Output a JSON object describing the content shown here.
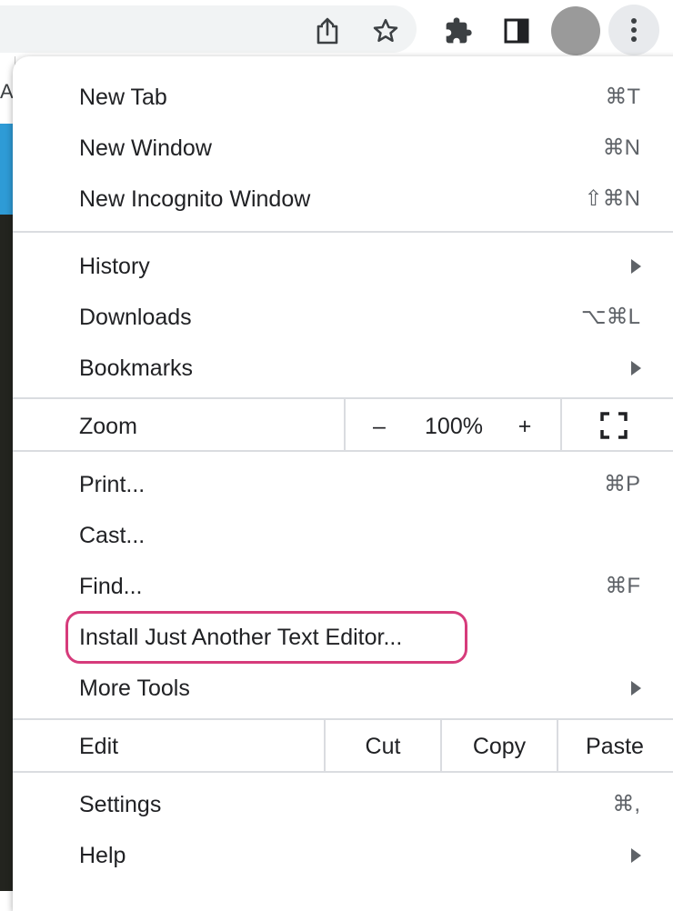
{
  "toolbar": {
    "icons": [
      "share-icon",
      "star-icon",
      "extensions-icon",
      "side-panel-icon",
      "profile-avatar",
      "more-menu-icon"
    ]
  },
  "page_behind": {
    "fragment": "AF"
  },
  "menu": {
    "new_tab": {
      "label": "New Tab",
      "shortcut": "⌘T"
    },
    "new_window": {
      "label": "New Window",
      "shortcut": "⌘N"
    },
    "new_incognito": {
      "label": "New Incognito Window",
      "shortcut": "⇧⌘N"
    },
    "history": {
      "label": "History"
    },
    "downloads": {
      "label": "Downloads",
      "shortcut": "⌥⌘L"
    },
    "bookmarks": {
      "label": "Bookmarks"
    },
    "zoom": {
      "label": "Zoom",
      "minus": "–",
      "level": "100%",
      "plus": "+"
    },
    "print": {
      "label": "Print...",
      "shortcut": "⌘P"
    },
    "cast": {
      "label": "Cast..."
    },
    "find": {
      "label": "Find...",
      "shortcut": "⌘F"
    },
    "install": {
      "label": "Install Just Another Text Editor..."
    },
    "more_tools": {
      "label": "More Tools"
    },
    "edit": {
      "label": "Edit",
      "cut": "Cut",
      "copy": "Copy",
      "paste": "Paste"
    },
    "settings": {
      "label": "Settings",
      "shortcut": "⌘,"
    },
    "help": {
      "label": "Help"
    }
  },
  "colors": {
    "highlight": "#d63b7b",
    "separator": "#dadce0",
    "text": "#202124"
  }
}
